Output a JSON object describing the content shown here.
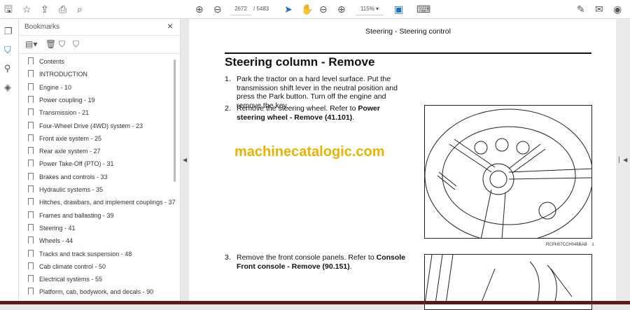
{
  "toolbar": {
    "page_current": "2672",
    "page_total": "/ 5483",
    "zoom": "115%",
    "icons": [
      "save-icon",
      "star-icon",
      "upload-icon",
      "print-icon",
      "search-icon",
      "page-up-icon",
      "page-down-icon",
      "select-icon",
      "hand-icon",
      "zoom-out-icon",
      "zoom-in-icon",
      "fit-icon",
      "comment-icon",
      "sign-icon",
      "mail-icon",
      "account-icon"
    ]
  },
  "bookmarks": {
    "title": "Bookmarks",
    "close": "×",
    "items": [
      "Contents",
      "INTRODUCTION",
      "Engine - 10",
      "Power coupling - 19",
      "Transmission - 21",
      "Four-Wheel Drive (4WD) system - 23",
      "Front axle system - 25",
      "Rear axle system - 27",
      "Power Take-Off (PTO) - 31",
      "Brakes and controls - 33",
      "Hydraulic systems - 35",
      "Hitches, drawbars, and implement couplings - 37",
      "Frames and ballasting - 39",
      "Steering - 41",
      "Wheels - 44",
      "Tracks and track suspension - 48",
      "Cab climate control - 50",
      "Electrical systems - 55",
      "Platform, cab, bodywork, and decals - 90"
    ]
  },
  "doc": {
    "header": "Steering - Steering control",
    "title": "Steering column - Remove",
    "steps": [
      {
        "n": "1.",
        "text": "Park the tractor on a hard level surface. Put the transmission shift lever in the neutral position and press the Park button. Turn off the engine and remove the key.",
        "bold": ""
      },
      {
        "n": "2.",
        "text": "Remove the steering wheel. Refer to ",
        "bold": "Power steering wheel - Remove (41.101)",
        "end": "."
      },
      {
        "n": "3.",
        "text": "Remove the front console panels. Refer to ",
        "bold": "Console Front console - Remove (90.151)",
        "end": "."
      }
    ],
    "figure_caption": "RCPH07CCH046BAB",
    "figure_number": "1",
    "watermark": "machinecatalogic.com"
  }
}
